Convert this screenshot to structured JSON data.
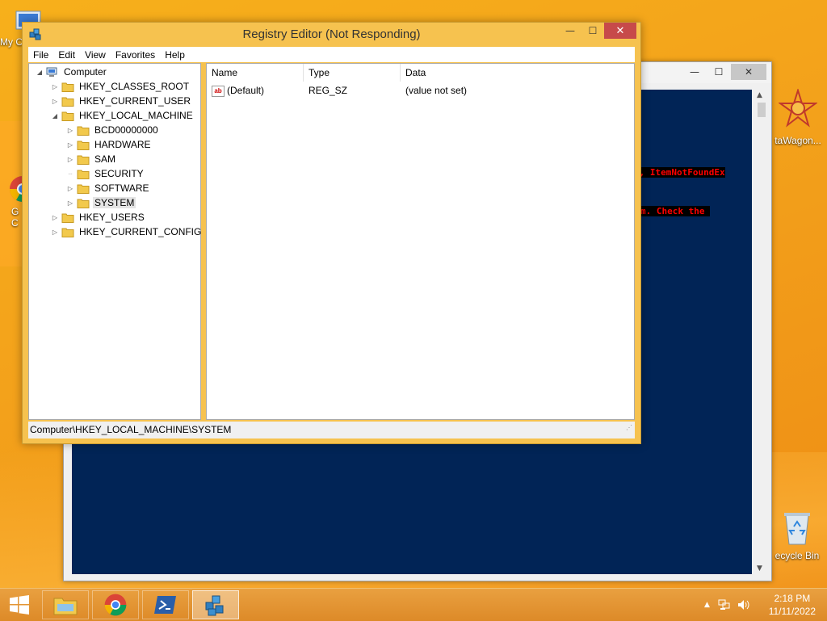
{
  "desktop": {
    "icons": [
      {
        "label": "My C",
        "icon": "computer-icon"
      },
      {
        "label": "G",
        "label2": "C",
        "icon": "chrome-icon"
      },
      {
        "label": "taWagon...",
        "icon": "datawagon-icon"
      },
      {
        "label": "ecycle Bin",
        "icon": "recycle-bin-icon"
      }
    ]
  },
  "powershell": {
    "controls": {
      "minimize": "—",
      "maximize": "☐",
      "close": "✕"
    },
    "errors": [
      "], ItemNotFoundEx",
      "m. Check the "
    ],
    "colors": {
      "background": "#012456",
      "error_fg": "#ff0000"
    }
  },
  "regedit": {
    "title": "Registry Editor (Not Responding)",
    "controls": {
      "minimize": "—",
      "maximize": "☐",
      "close": "✕"
    },
    "menu": [
      "File",
      "Edit",
      "View",
      "Favorites",
      "Help"
    ],
    "tree": {
      "root": "Computer",
      "hives": [
        "HKEY_CLASSES_ROOT",
        "HKEY_CURRENT_USER",
        "HKEY_LOCAL_MACHINE"
      ],
      "hklm_children": [
        "BCD00000000",
        "HARDWARE",
        "SAM",
        "SECURITY",
        "SOFTWARE",
        "SYSTEM"
      ],
      "other_hives": [
        "HKEY_USERS",
        "HKEY_CURRENT_CONFIG"
      ],
      "selected": "SYSTEM"
    },
    "columns": [
      "Name",
      "Type",
      "Data"
    ],
    "values": [
      {
        "name": "(Default)",
        "type": "REG_SZ",
        "data": "(value not set)"
      }
    ],
    "status_path": "Computer\\HKEY_LOCAL_MACHINE\\SYSTEM",
    "colors": {
      "frame": "#f6c24f",
      "close": "#c74a4a"
    }
  },
  "taskbar": {
    "pinned": [
      "file-explorer-icon",
      "chrome-icon",
      "powershell-icon",
      "regedit-icon"
    ],
    "active": "regedit-icon",
    "clock": {
      "time": "2:18 PM",
      "date": "11/11/2022"
    }
  }
}
